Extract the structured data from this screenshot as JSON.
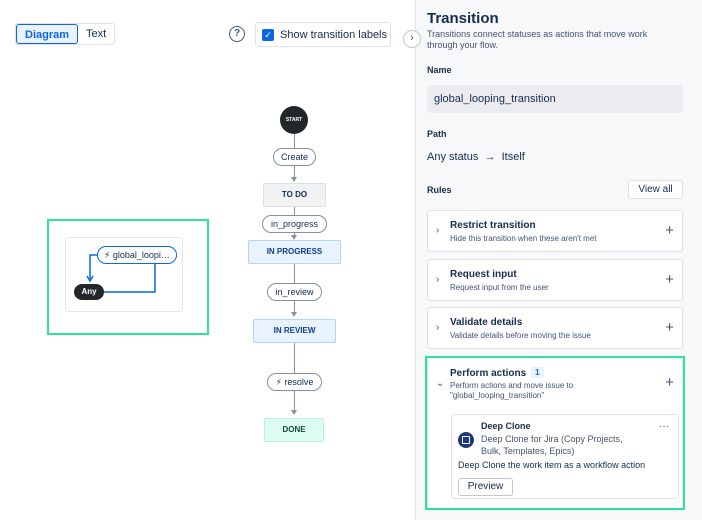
{
  "view_toggle": {
    "diagram": "Diagram",
    "text": "Text"
  },
  "help": {
    "glyph": "?"
  },
  "show_labels": {
    "label": "Show transition labels",
    "checked": true
  },
  "loop_card": {
    "transition": "global_loopi…",
    "status": "Any"
  },
  "flow": {
    "start": "START",
    "t_create": "Create",
    "s_todo": "TO DO",
    "t_in_progress": "in_progress",
    "s_in_progress": "IN PROGRESS",
    "t_in_review": "in_review",
    "s_in_review": "IN REVIEW",
    "t_resolve": "resolve",
    "s_done": "DONE"
  },
  "panel": {
    "collapse_glyph": "›",
    "title": "Transition",
    "description": "Transitions connect statuses as actions that move work through your flow.",
    "name_label": "Name",
    "name_value": "global_looping_transition",
    "path_label": "Path",
    "path_from": "Any status",
    "path_arrow": "→",
    "path_to": "Itself",
    "rules_label": "Rules",
    "view_all": "View all"
  },
  "rules": [
    {
      "title": "Restrict transition",
      "subtitle": "Hide this transition when these aren't met"
    },
    {
      "title": "Request input",
      "subtitle": "Request input from the user"
    },
    {
      "title": "Validate details",
      "subtitle": "Validate details before moving the issue"
    }
  ],
  "perform_actions": {
    "title": "Perform actions",
    "count": "1",
    "subtitle": "Perform actions and move issue to \"global_looping_transition\""
  },
  "action": {
    "app_name": "Deep Clone",
    "app_desc": "Deep Clone for Jira (Copy Projects, Bulk, Templates, Epics)",
    "action_desc": "Deep Clone the work item as a workflow action",
    "preview": "Preview",
    "more_glyph": "···"
  },
  "icons": {
    "chevron_right": "›",
    "chevron_down": "⌄",
    "plus": "+",
    "bolt": "⚡",
    "check": "✓"
  },
  "colors": {
    "accent": "#0c66e4",
    "highlight": "#2ee39a",
    "done": "#dcfff1",
    "progress": "#e9f2ff"
  }
}
